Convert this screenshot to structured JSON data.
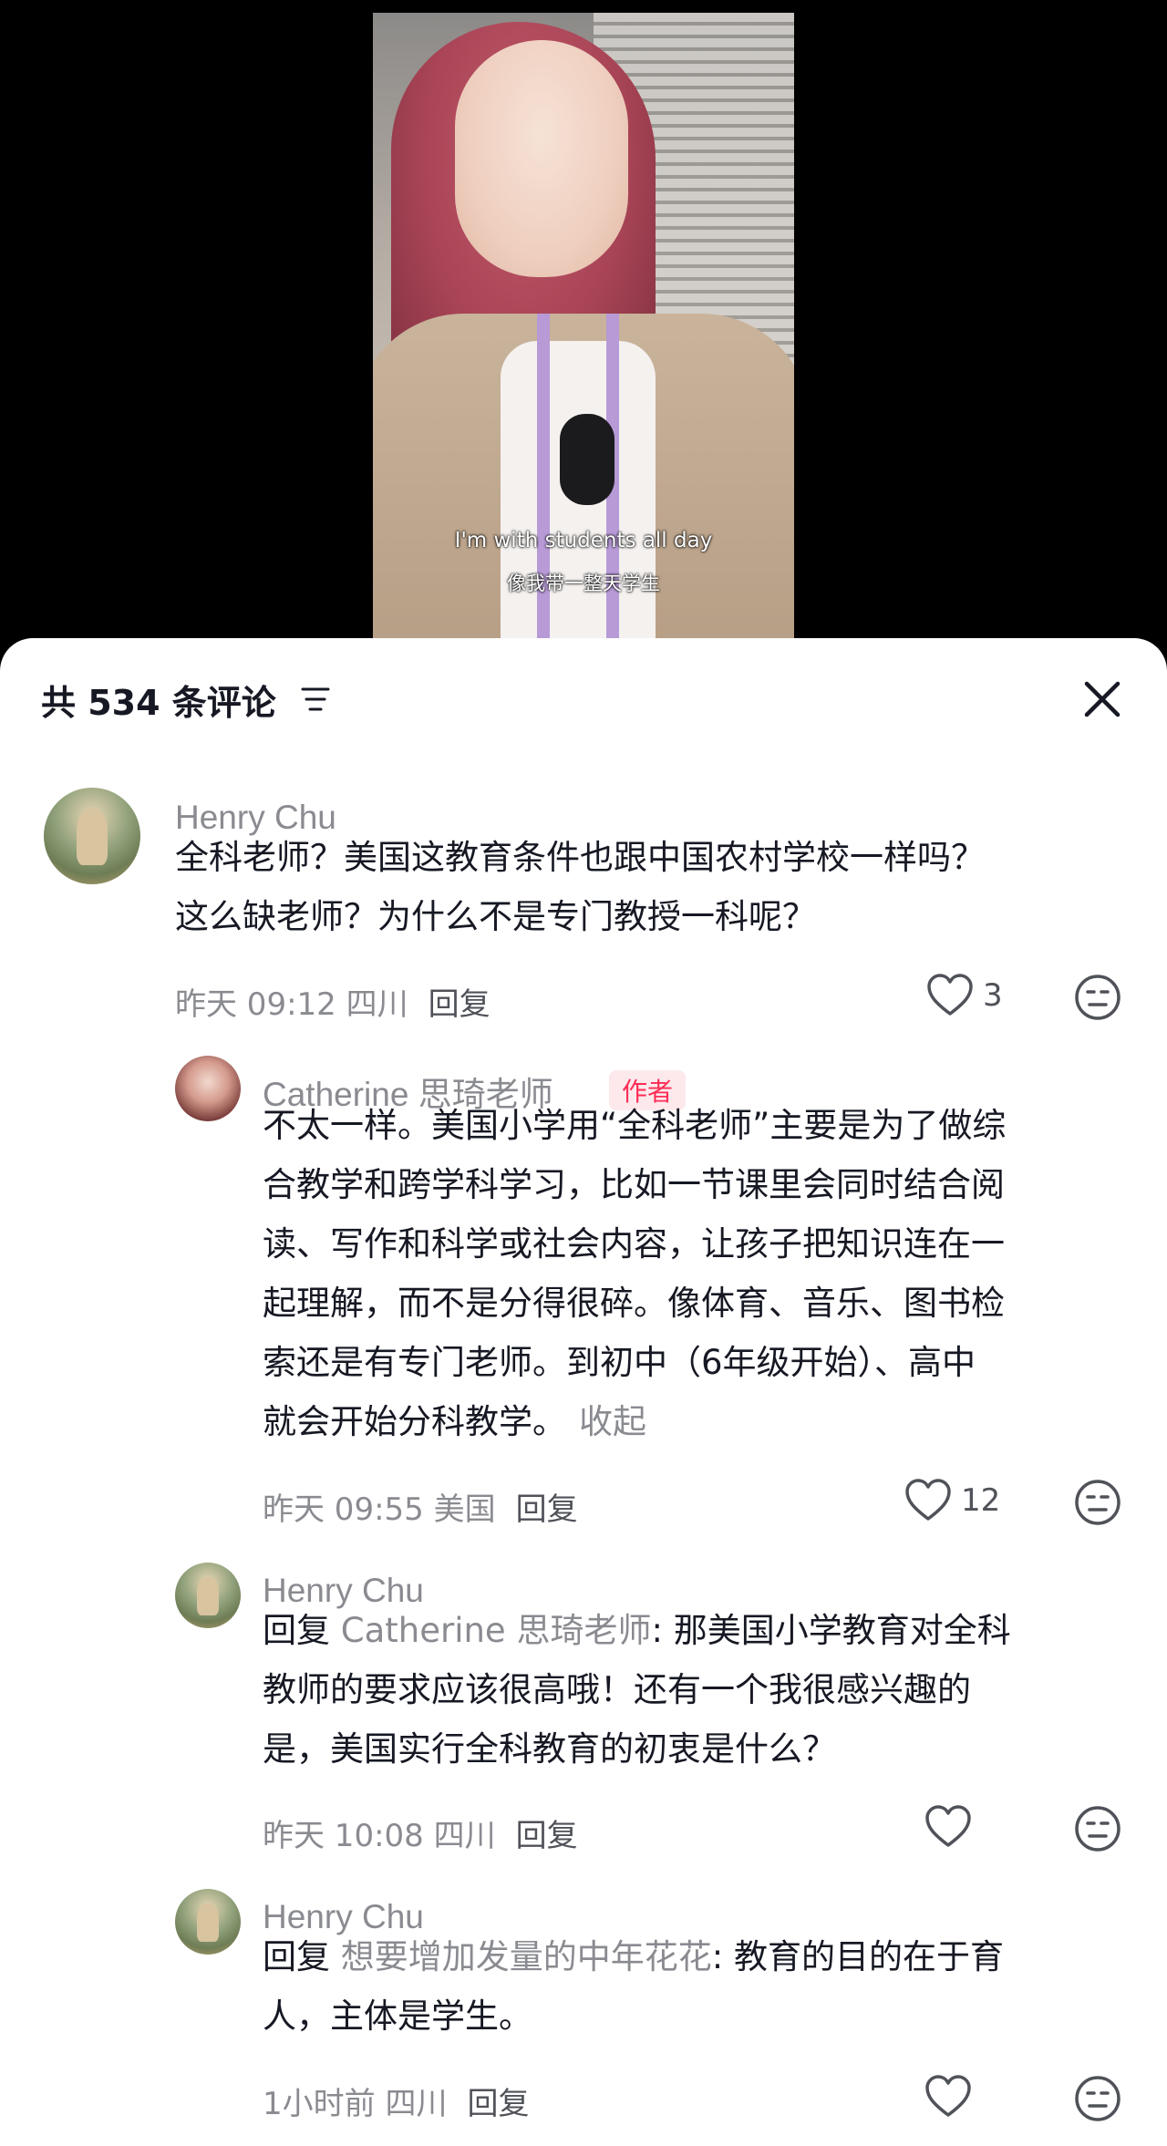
{
  "video": {
    "caption_en": "I'm with students all day",
    "caption_zh": "像我带一整天学生"
  },
  "comments_header": {
    "title": "共 534 条评论",
    "filter_icon": "filter-icon",
    "close_icon": "close-icon"
  },
  "comments": [
    {
      "username": "Henry Chu",
      "lines": [
        "全科老师？美国这教育条件也跟中国农村学校一样吗？",
        "这么缺老师？为什么不是专门教授一科呢？"
      ],
      "time": "昨天 09:12 四川",
      "reply_label": "回复",
      "likes": "3"
    },
    {
      "username": "Catherine 思琦老师",
      "badge": "作者",
      "lines": [
        "不太一样。美国小学用“全科老师”主要是为了做综",
        "合教学和跨学科学习，比如一节课里会同时结合阅",
        "读、写作和科学或社会内容，让孩子把知识连在一",
        "起理解，而不是分得很碎。像体育、音乐、图书检",
        "索还是有专门老师。到初中（6年级开始）、高中",
        "就会开始分科教学。"
      ],
      "collapse_label": "收起",
      "time": "昨天 09:55 美国",
      "reply_label": "回复",
      "likes": "12"
    },
    {
      "username": "Henry Chu",
      "reply_prefix": "回复",
      "reply_target": "Catherine 思琦老师",
      "lines": [
        ": 那美国小学教育对全科",
        "教师的要求应该很高哦！还有一个我很感兴趣的",
        "是，美国实行全科教育的初衷是什么？"
      ],
      "time": "昨天 10:08 四川",
      "reply_label": "回复",
      "likes": ""
    },
    {
      "username": "Henry Chu",
      "reply_prefix": "回复",
      "reply_target": "想要增加发量的中年花花",
      "lines": [
        ": 教育的目的在于育",
        "人，主体是学生。"
      ],
      "time": "1小时前 四川",
      "reply_label": "回复",
      "likes": ""
    }
  ],
  "colors": {
    "text_primary": "#161823",
    "text_secondary": "#8a8b91",
    "author_badge_bg": "#fde9ec",
    "author_badge_text": "#fe2c55"
  }
}
